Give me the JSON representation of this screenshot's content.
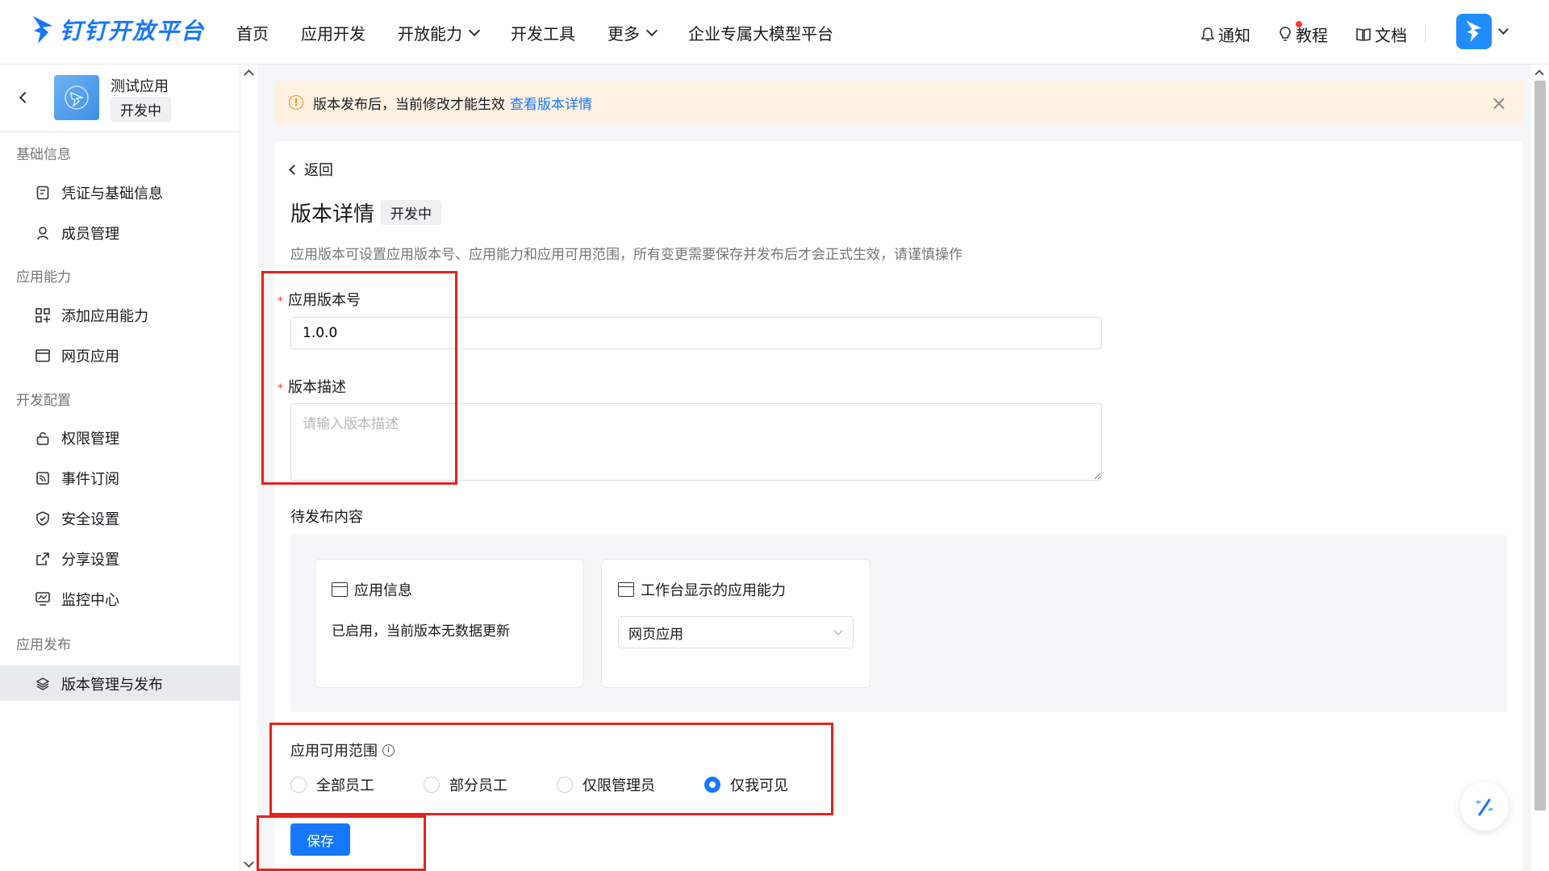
{
  "brand": {
    "name": "钉钉开放平台",
    "color": "#1677ff"
  },
  "nav": [
    {
      "label": "首页",
      "dropdown": false
    },
    {
      "label": "应用开发",
      "dropdown": false
    },
    {
      "label": "开放能力",
      "dropdown": true
    },
    {
      "label": "开发工具",
      "dropdown": false
    },
    {
      "label": "更多",
      "dropdown": true
    },
    {
      "label": "企业专属大模型平台",
      "dropdown": false
    }
  ],
  "tools": {
    "notify": "通知",
    "tutorial": "教程",
    "docs": "文档"
  },
  "app": {
    "name": "测试应用",
    "status": "开发中"
  },
  "sidebar": {
    "groups": [
      {
        "label": "基础信息",
        "items": [
          {
            "label": "凭证与基础信息",
            "icon": "credential-icon"
          },
          {
            "label": "成员管理",
            "icon": "user-icon"
          }
        ]
      },
      {
        "label": "应用能力",
        "items": [
          {
            "label": "添加应用能力",
            "icon": "grid-add-icon"
          },
          {
            "label": "网页应用",
            "icon": "window-icon"
          }
        ]
      },
      {
        "label": "开发配置",
        "items": [
          {
            "label": "权限管理",
            "icon": "lock-icon"
          },
          {
            "label": "事件订阅",
            "icon": "rss-icon"
          },
          {
            "label": "安全设置",
            "icon": "shield-icon"
          },
          {
            "label": "分享设置",
            "icon": "share-icon"
          },
          {
            "label": "监控中心",
            "icon": "monitor-icon"
          }
        ]
      },
      {
        "label": "应用发布",
        "items": [
          {
            "label": "版本管理与发布",
            "icon": "layers-icon",
            "active": true
          }
        ]
      }
    ]
  },
  "notice": {
    "text": "版本发布后，当前修改才能生效",
    "link": "查看版本详情",
    "color": "#fdf1e1"
  },
  "detail": {
    "back": "返回",
    "title": "版本详情",
    "status": "开发中",
    "description": "应用版本可设置应用版本号、应用能力和应用可用范围，所有变更需要保存并发布后才会正式生效，请谨慎操作",
    "version_label": "应用版本号",
    "version_value": "1.0.0",
    "desc_label": "版本描述",
    "desc_placeholder": "请输入版本描述",
    "pending_label": "待发布内容",
    "app_info_title": "应用信息",
    "app_info_text": "已启用，当前版本无数据更新",
    "workbench_title": "工作台显示的应用能力",
    "workbench_selected": "网页应用",
    "scope_label": "应用可用范围",
    "scope_options": [
      {
        "label": "全部员工",
        "checked": false
      },
      {
        "label": "部分员工",
        "checked": false
      },
      {
        "label": "仅限管理员",
        "checked": false
      },
      {
        "label": "仅我可见",
        "checked": true
      }
    ],
    "save": "保存"
  },
  "highlight_color": "#e5231c"
}
